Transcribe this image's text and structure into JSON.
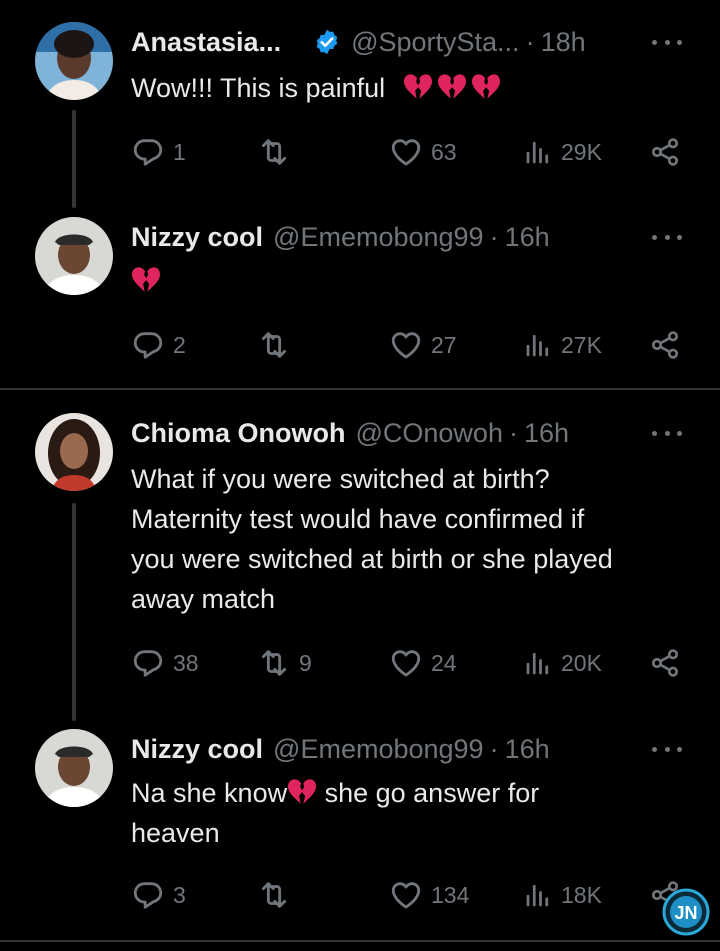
{
  "tweets": [
    {
      "name": "Anastasia...",
      "handle": "@SportySta...",
      "time": "18h",
      "verified": true,
      "text": "Wow!!! This is painful",
      "emoji_count": 3,
      "replies": "1",
      "retweets": "",
      "likes": "63",
      "views": "29K"
    },
    {
      "name": "Nizzy cool",
      "handle": "@Ememobong99",
      "time": "16h",
      "verified": false,
      "text": "",
      "emoji_count": 1,
      "replies": "2",
      "retweets": "",
      "likes": "27",
      "views": "27K"
    },
    {
      "name": "Chioma Onowoh",
      "handle": "@COnowoh",
      "time": "16h",
      "verified": false,
      "text_lines": [
        "What if you were switched at birth?",
        "Maternity test would have confirmed if",
        "you were switched at birth or she played",
        "away match"
      ],
      "replies": "38",
      "retweets": "9",
      "likes": "24",
      "views": "20K"
    },
    {
      "name": "Nizzy cool",
      "handle": "@Ememobong99",
      "time": "16h",
      "verified": false,
      "text_before": "Na she know",
      "text_after": " she go answer for",
      "text_line2": "heaven",
      "replies": "3",
      "retweets": "",
      "likes": "134",
      "views": "18K"
    }
  ],
  "separator": "·",
  "icons": {
    "reply": "reply-icon",
    "retweet": "retweet-icon",
    "like": "heart-outline-icon",
    "views": "analytics-icon",
    "share": "share-icon",
    "verified": "verified-badge-icon",
    "broken_heart": "broken-heart-icon",
    "more": "more-icon"
  },
  "colors": {
    "background": "#000000",
    "text": "#e7e9ea",
    "muted": "#71767b",
    "verified": "#1d9bf0",
    "broken_heart": "#e0245e"
  },
  "watermark": {
    "label": "JN"
  }
}
